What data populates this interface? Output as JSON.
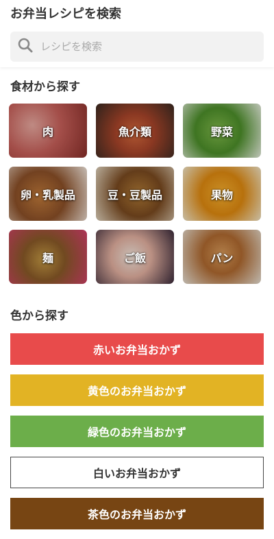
{
  "header": {
    "title": "お弁当レシピを検索",
    "search_placeholder": "レシピを検索"
  },
  "ingredients": {
    "title": "食材から探す",
    "items": [
      {
        "label": "肉"
      },
      {
        "label": "魚介類"
      },
      {
        "label": "野菜"
      },
      {
        "label": "卵・乳製品"
      },
      {
        "label": "豆・豆製品"
      },
      {
        "label": "果物"
      },
      {
        "label": "麺"
      },
      {
        "label": "ご飯"
      },
      {
        "label": "パン"
      }
    ]
  },
  "colors": {
    "title": "色から探す",
    "items": [
      {
        "label": "赤いお弁当おかず",
        "color": "#e84b4b"
      },
      {
        "label": "黄色のお弁当おかず",
        "color": "#e2b324"
      },
      {
        "label": "緑色のお弁当おかず",
        "color": "#6cae4a"
      },
      {
        "label": "白いお弁当おかず",
        "color": "#ffffff"
      },
      {
        "label": "茶色のお弁当おかず",
        "color": "#774513"
      }
    ]
  }
}
